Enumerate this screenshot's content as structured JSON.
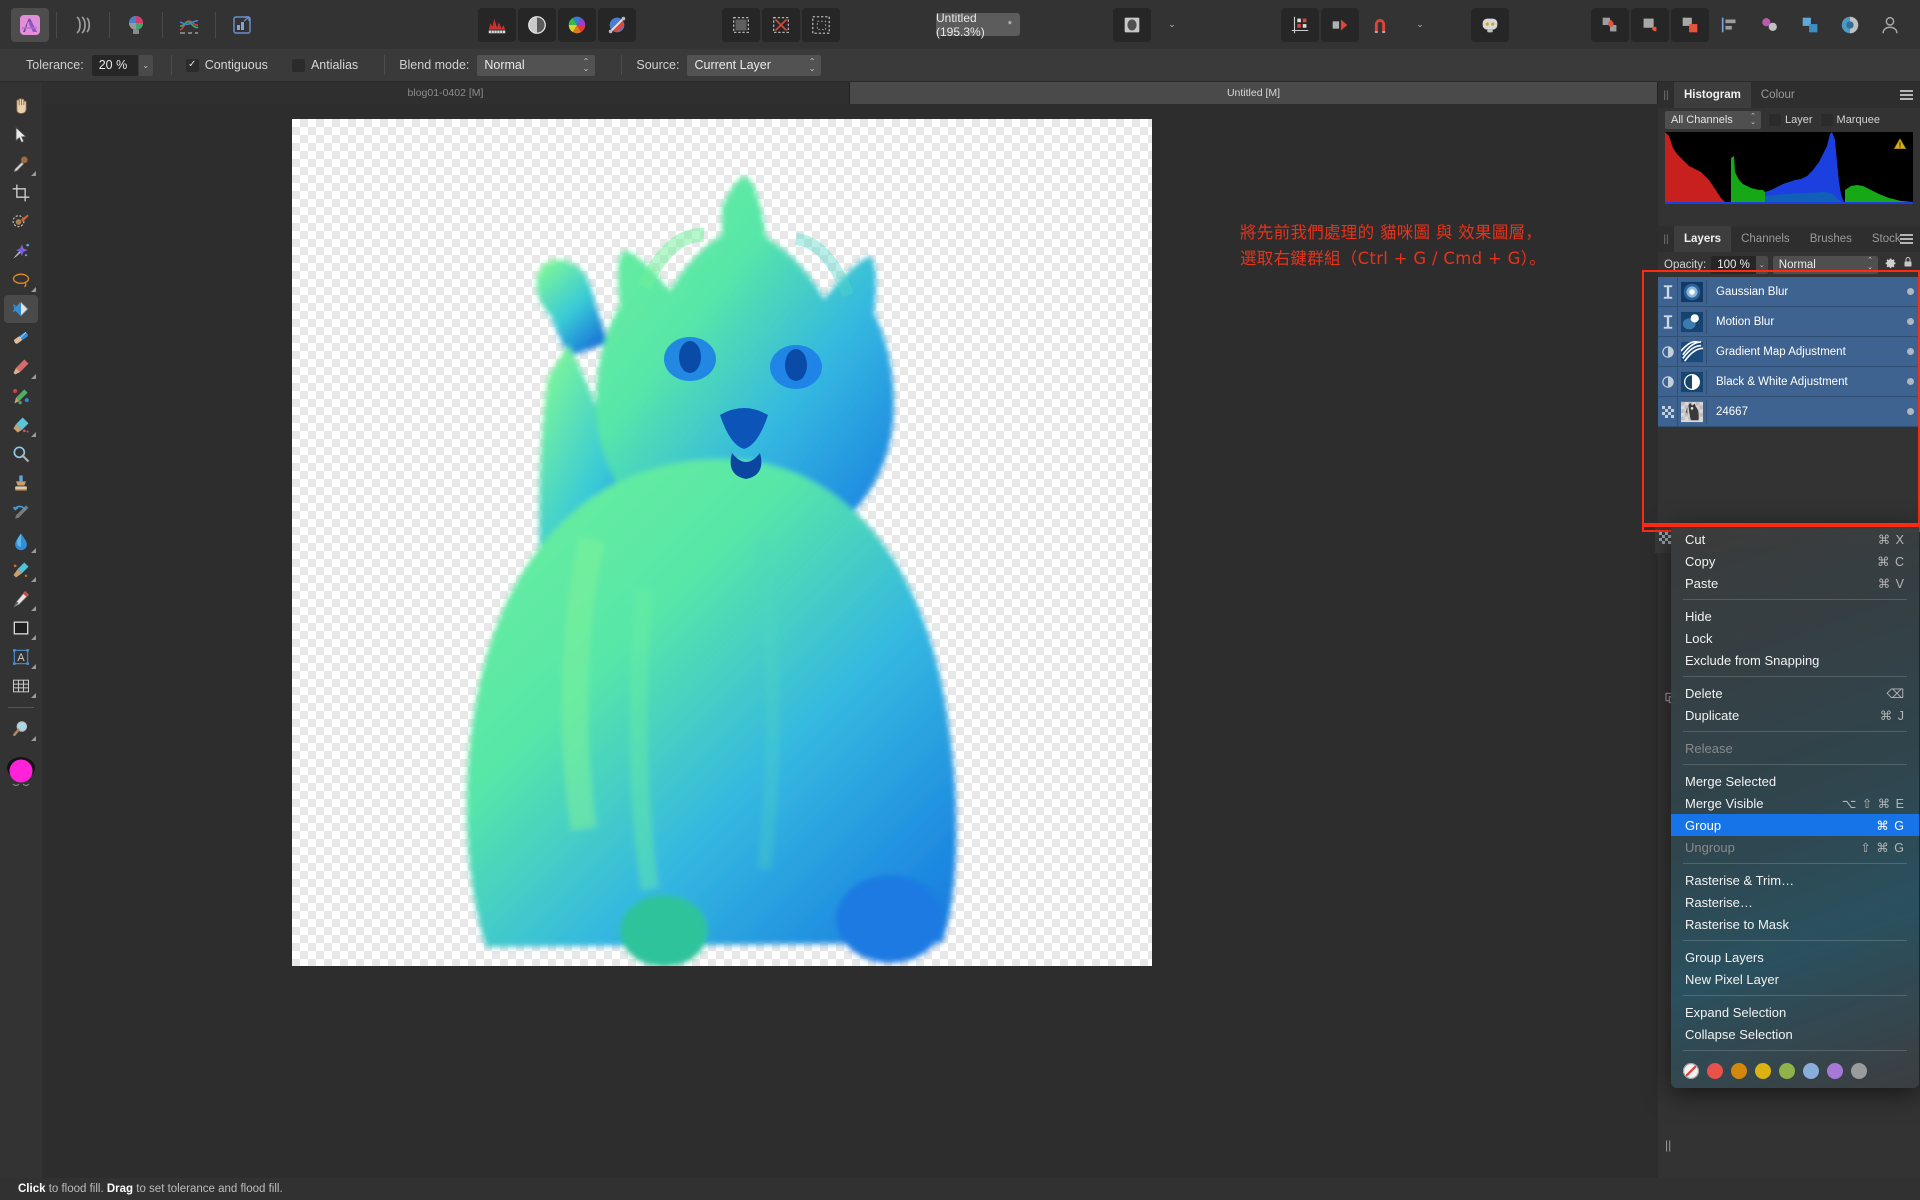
{
  "app": {
    "name": "Affinity Photo",
    "persona_icon": "affinity-photo-icon"
  },
  "toolbar": {
    "personas": [
      {
        "name": "photo-persona-icon",
        "label": "Photo Persona",
        "active": true
      },
      {
        "name": "liquify-persona-icon",
        "label": "Liquify Persona",
        "active": false
      },
      {
        "name": "develop-persona-icon",
        "label": "Develop Persona",
        "active": false
      },
      {
        "name": "tone-mapping-persona-icon",
        "label": "Tone Mapping Persona",
        "active": false
      },
      {
        "name": "export-persona-icon",
        "label": "Export Persona",
        "active": false
      }
    ],
    "adjust_group": [
      {
        "name": "histogram-icon",
        "label": "Histogram"
      },
      {
        "name": "levels-icon",
        "label": "Levels"
      },
      {
        "name": "colour-wheel-icon",
        "label": "Colour"
      },
      {
        "name": "blend-ranges-icon",
        "label": "Blend Options"
      }
    ],
    "selection_group": [
      {
        "name": "refine-selection-icon",
        "label": "Refine Selection"
      },
      {
        "name": "deselect-icon",
        "label": "Deselect"
      },
      {
        "name": "invert-selection-icon",
        "label": "Invert Pixel Selection"
      }
    ],
    "document_title": "Untitled (195.3%)",
    "document_modified_marker": "*",
    "view_mode_icon": "view-mode-icon",
    "view_mode_chevron": "chevron-down-icon",
    "right_group": [
      {
        "name": "snapping-grid-icon",
        "label": "Show Grid"
      },
      {
        "name": "alignment-icon",
        "label": "Alignment"
      },
      {
        "name": "magnet-snapping-icon",
        "label": "Snapping"
      }
    ],
    "snapping_chevron": "chevron-down-icon",
    "assistant_icon": "assistant-robot-icon",
    "arrange_group": [
      {
        "name": "move-to-front-icon",
        "label": "Move to Front"
      },
      {
        "name": "move-to-back-icon",
        "label": "Move to Back"
      },
      {
        "name": "group-objects-icon",
        "label": "Group"
      },
      {
        "name": "align-left-icon",
        "label": "Align Left"
      },
      {
        "name": "distribute-icon",
        "label": "Distribute"
      },
      {
        "name": "colour-picker-icon",
        "label": "Colour Picker"
      },
      {
        "name": "mask-icon",
        "label": "Mask"
      }
    ],
    "account_icon": "account-avatar-icon"
  },
  "options_bar": {
    "tolerance_label": "Tolerance:",
    "tolerance_value": "20 %",
    "contiguous_label": "Contiguous",
    "contiguous_checked": true,
    "antialias_label": "Antialias",
    "antialias_checked": false,
    "blend_mode_label": "Blend mode:",
    "blend_mode_value": "Normal",
    "source_label": "Source:",
    "source_value": "Current Layer"
  },
  "tools": [
    {
      "name": "view-pan-tool",
      "glyph": "hand",
      "label": "View Tool"
    },
    {
      "name": "move-tool",
      "glyph": "arrow",
      "label": "Move Tool"
    },
    {
      "name": "colour-picker-tool",
      "glyph": "dropper",
      "label": "Colour Picker Tool"
    },
    {
      "name": "crop-tool",
      "glyph": "crop",
      "label": "Crop Tool"
    },
    {
      "name": "selection-brush-tool",
      "glyph": "selbrush",
      "label": "Selection Brush Tool"
    },
    {
      "name": "magic-wand-tool",
      "glyph": "wand",
      "label": "Flood Select Tool"
    },
    {
      "name": "freehand-selection-tool",
      "glyph": "lasso",
      "label": "Freehand Selection Tool"
    },
    {
      "name": "flood-fill-tool",
      "glyph": "floodfill",
      "label": "Flood Fill Tool",
      "selected": true
    },
    {
      "name": "gradient-tool",
      "glyph": "gradient",
      "label": "Gradient Tool"
    },
    {
      "name": "paint-brush-tool",
      "glyph": "paintbrush",
      "label": "Paint Brush Tool"
    },
    {
      "name": "paint-mixer-tool",
      "glyph": "mixer",
      "label": "Paint Mixer Brush Tool"
    },
    {
      "name": "erase-tool",
      "glyph": "eraser",
      "label": "Erase Brush Tool"
    },
    {
      "name": "dodge-burn-tool",
      "glyph": "dodge",
      "label": "Dodge Brush Tool"
    },
    {
      "name": "clone-stamp-tool",
      "glyph": "clone",
      "label": "Clone Brush Tool"
    },
    {
      "name": "inpainting-tool",
      "glyph": "inpaint",
      "label": "Inpainting Brush Tool"
    },
    {
      "name": "blur-tool",
      "glyph": "blur",
      "label": "Blur Brush Tool"
    },
    {
      "name": "smudge-tool",
      "glyph": "smudge",
      "label": "Smudge Brush Tool"
    },
    {
      "name": "pen-tool",
      "glyph": "pen",
      "label": "Pen Tool"
    },
    {
      "name": "rectangle-tool",
      "glyph": "rect",
      "label": "Rectangle Tool"
    },
    {
      "name": "text-tool",
      "glyph": "text",
      "label": "Artistic Text Tool"
    },
    {
      "name": "mesh-warp-tool",
      "glyph": "mesh",
      "label": "Mesh Warp Tool"
    },
    {
      "name": "zoom-tool",
      "glyph": "zoom",
      "label": "Zoom Tool"
    }
  ],
  "colour_swatch": {
    "fill": "#ff22d8",
    "stroke": "#1c1c1c"
  },
  "document_tabs": [
    {
      "label": "blog01-0402 [M]",
      "active": false
    },
    {
      "label": "Untitled [M]",
      "active": true
    }
  ],
  "annotation": {
    "text": "將先前我們處理的 貓咪圖 與 效果圖層，\n選取右鍵群組（Ctrl + G / Cmd + G）。",
    "color": "#e8321a"
  },
  "histogram_panel": {
    "tabs": [
      {
        "label": "Histogram",
        "active": true
      },
      {
        "label": "Colour",
        "active": false
      }
    ],
    "channel_select": "All Channels",
    "layer_checkbox": "Layer",
    "marquee_checkbox": "Marquee",
    "warning_icon": "clipping-warning-icon"
  },
  "layers_panel": {
    "tabs": [
      {
        "label": "Layers",
        "active": true
      },
      {
        "label": "Channels",
        "active": false
      },
      {
        "label": "Brushes",
        "active": false
      },
      {
        "label": "Stock",
        "active": false
      }
    ],
    "opacity_label": "Opacity:",
    "opacity_value": "100 %",
    "blend_mode_value": "Normal",
    "settings_icon": "gear-icon",
    "lock_icon": "lock-icon",
    "layers": [
      {
        "name": "Gaussian Blur",
        "kind": "live-filter",
        "thumb": "gaussian-blur-thumb",
        "selected": true
      },
      {
        "name": "Motion Blur",
        "kind": "live-filter",
        "thumb": "motion-blur-thumb",
        "selected": true
      },
      {
        "name": "Gradient Map Adjustment",
        "kind": "adjustment",
        "thumb": "gradient-map-thumb",
        "selected": true
      },
      {
        "name": "Black & White Adjustment",
        "kind": "adjustment",
        "thumb": "black-white-thumb",
        "selected": true
      },
      {
        "name": "24667",
        "kind": "pixel",
        "thumb": "cat-pixel-thumb",
        "selected": true
      }
    ],
    "selection_highlight_color": "#ff2a12"
  },
  "context_menu": {
    "items": [
      {
        "label": "Cut",
        "shortcut": "⌘ X",
        "state": "normal"
      },
      {
        "label": "Copy",
        "shortcut": "⌘ C",
        "state": "normal"
      },
      {
        "label": "Paste",
        "shortcut": "⌘ V",
        "state": "normal"
      },
      {
        "separator": true
      },
      {
        "label": "Hide",
        "shortcut": "",
        "state": "normal"
      },
      {
        "label": "Lock",
        "shortcut": "",
        "state": "normal"
      },
      {
        "label": "Exclude from Snapping",
        "shortcut": "",
        "state": "normal"
      },
      {
        "separator": true
      },
      {
        "label": "Delete",
        "shortcut": "⌫",
        "state": "normal"
      },
      {
        "label": "Duplicate",
        "shortcut": "⌘ J",
        "state": "normal"
      },
      {
        "separator": true
      },
      {
        "label": "Release",
        "shortcut": "",
        "state": "disabled"
      },
      {
        "separator": true
      },
      {
        "label": "Merge Selected",
        "shortcut": "",
        "state": "normal"
      },
      {
        "label": "Merge Visible",
        "shortcut": "⌥ ⇧ ⌘ E",
        "state": "normal"
      },
      {
        "label": "Group",
        "shortcut": "⌘ G",
        "state": "highlighted"
      },
      {
        "label": "Ungroup",
        "shortcut": "⇧ ⌘ G",
        "state": "disabled"
      },
      {
        "separator": true
      },
      {
        "label": "Rasterise & Trim…",
        "shortcut": "",
        "state": "normal"
      },
      {
        "label": "Rasterise…",
        "shortcut": "",
        "state": "normal"
      },
      {
        "label": "Rasterise to Mask",
        "shortcut": "",
        "state": "normal"
      },
      {
        "separator": true
      },
      {
        "label": "Group Layers",
        "shortcut": "",
        "state": "normal"
      },
      {
        "label": "New Pixel Layer",
        "shortcut": "",
        "state": "normal"
      },
      {
        "separator": true
      },
      {
        "label": "Expand Selection",
        "shortcut": "",
        "state": "normal"
      },
      {
        "label": "Collapse Selection",
        "shortcut": "",
        "state": "normal"
      }
    ],
    "colour_tags": [
      "none",
      "#e8524a",
      "#d2880c",
      "#dcb312",
      "#8fb24a",
      "#8aaedb",
      "#a779d6",
      "#9b9b9b"
    ],
    "highlight_color": "#1673e8"
  },
  "status_bar": {
    "prefix_bold_1": "Click",
    "text_1": " to flood fill. ",
    "prefix_bold_2": "Drag",
    "text_2": " to set tolerance and flood fill."
  }
}
